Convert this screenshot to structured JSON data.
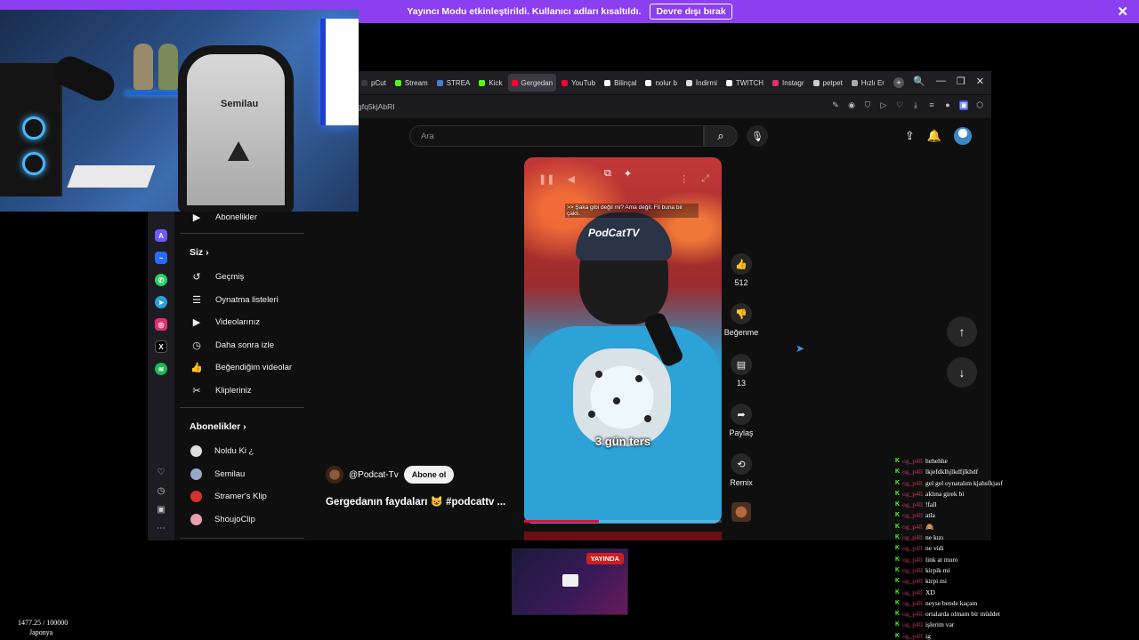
{
  "banner": {
    "message": "Yayıncı Modu etkinleştirildi. Kullanıcı adları kısaltıldı.",
    "button": "Devre dışı bırak",
    "close": "✕"
  },
  "webcam": {
    "chair_brand": "Semilau"
  },
  "browser": {
    "tabs": [
      {
        "label": "pCut",
        "color": "#3a3a3a",
        "active": false
      },
      {
        "label": "Stream",
        "color": "#53fc18",
        "active": false
      },
      {
        "label": "STREA",
        "color": "#4a7bd6",
        "active": false
      },
      {
        "label": "Kick",
        "color": "#53fc18",
        "active": false
      },
      {
        "label": "Gergedan",
        "color": "#ff0033",
        "active": true
      },
      {
        "label": "YouTub",
        "color": "#ff0033",
        "active": false
      },
      {
        "label": "Bilinçal",
        "color": "#ffffff",
        "active": false
      },
      {
        "label": "nolur b",
        "color": "#ffffff",
        "active": false
      },
      {
        "label": "İndirmi",
        "color": "#dddddd",
        "active": false
      },
      {
        "label": "TWITCH",
        "color": "#ffffff",
        "active": false
      },
      {
        "label": "Instagr",
        "color": "#e1306c",
        "active": false
      },
      {
        "label": "petpet",
        "color": "#cccccc",
        "active": false
      },
      {
        "label": "Hızlı Er",
        "color": "#aaaaaa",
        "active": false
      }
    ],
    "url": "gfq5kjAbRI",
    "window_controls": [
      "🔍",
      "—",
      "❐",
      "✕"
    ]
  },
  "youtube": {
    "search_placeholder": "Ara",
    "sidebar": {
      "top_item": "Abonelikler",
      "siz_heading": "Siz",
      "siz_items": [
        {
          "label": "Geçmiş",
          "icon": "history-icon",
          "glyph": "↺"
        },
        {
          "label": "Oynatma listeleri",
          "icon": "playlist-icon",
          "glyph": "☰"
        },
        {
          "label": "Videolarınız",
          "icon": "video-icon",
          "glyph": "▶"
        },
        {
          "label": "Daha sonra izle",
          "icon": "clock-icon",
          "glyph": "◷"
        },
        {
          "label": "Beğendiğim videolar",
          "icon": "like-icon",
          "glyph": "👍"
        },
        {
          "label": "Klipleriniz",
          "icon": "scissors-icon",
          "glyph": "✂"
        }
      ],
      "subs_heading": "Abonelikler",
      "subs": [
        {
          "label": "Noldu Ki ¿",
          "color": "#e0e0e0"
        },
        {
          "label": "Semilau",
          "color": "#9aa8c8"
        },
        {
          "label": "Stramer's Klip",
          "color": "#d43030"
        },
        {
          "label": "ShoujoClip",
          "color": "#e8a0b0"
        }
      ]
    },
    "video": {
      "caption_top": ">> Şaka gibi değil mi? Ama değil. Fil buna bir çaktı.",
      "beanie_text": "PodCatTV",
      "caption_mid": "3 gün ters",
      "channel": "@Podcat-Tv",
      "subscribe": "Abone ol",
      "title": "Gergedanın faydaları 😺 #podcattv ...",
      "progress": 0.38
    },
    "actions": {
      "likes": "512",
      "dislike": "Beğenme",
      "comments": "13",
      "share": "Paylaş",
      "remix": "Remix"
    }
  },
  "preview": {
    "badge": "YAYINDA"
  },
  "stats": {
    "count": "1477.25 / 100000",
    "country": "Japonya"
  },
  "chat": {
    "user": "og_p4ll",
    "messages": [
      "hehehhe",
      "lkjefdklhjlkdfjlkhdf",
      "gel gel oynatalım kjahsfkjasf",
      "aklına girek bi",
      "!fall",
      "atla",
      "🙈",
      "ne kızı",
      "ne vidi",
      "link at muro",
      "kirpik mi",
      "kirpi mi",
      "XD",
      "neyse bende kaçam",
      "ortalarda olmam bir müddet",
      "işlerim var",
      "ig"
    ]
  }
}
